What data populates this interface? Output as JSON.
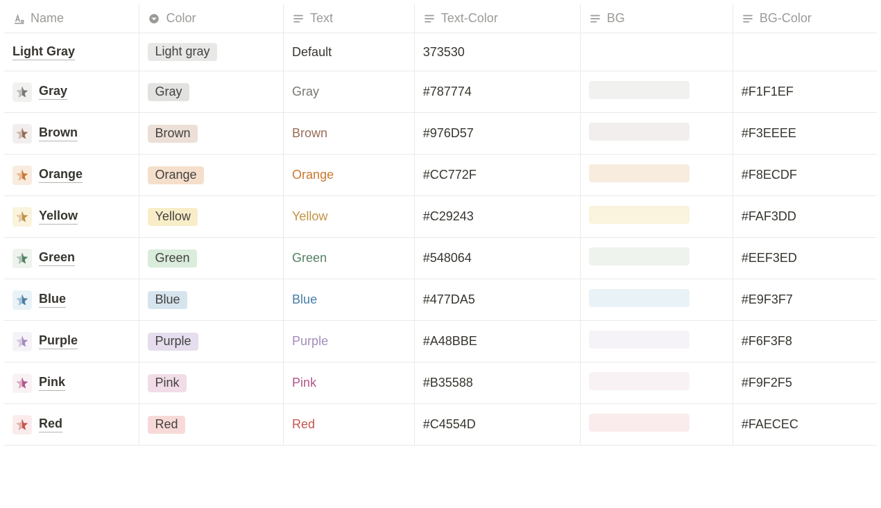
{
  "columns": {
    "name": "Name",
    "color": "Color",
    "text": "Text",
    "text_color": "Text-Color",
    "bg": "BG",
    "bg_color": "BG-Color"
  },
  "rows": [
    {
      "name": "Light Gray",
      "tag_label": "Light gray",
      "tag_bg": "#E8E8E6",
      "text": "Default",
      "text_hex": "373530",
      "text_css": "#373530",
      "bg_hex": "",
      "star_bg": "",
      "star_fill": ""
    },
    {
      "name": "Gray",
      "tag_label": "Gray",
      "tag_bg": "#E2E2E0",
      "text": "Gray",
      "text_hex": "#787774",
      "text_css": "#787774",
      "bg_hex": "#F1F1EF",
      "star_bg": "#F1F1EF",
      "star_fill": "#787774"
    },
    {
      "name": "Brown",
      "tag_label": "Brown",
      "tag_bg": "#ECDFD7",
      "text": "Brown",
      "text_hex": "#976D57",
      "text_css": "#976D57",
      "bg_hex": "#F3EEEE",
      "star_bg": "#F3EEEE",
      "star_fill": "#976D57"
    },
    {
      "name": "Orange",
      "tag_label": "Orange",
      "tag_bg": "#F5DFCC",
      "text": "Orange",
      "text_hex": "#CC772F",
      "text_css": "#CC772F",
      "bg_hex": "#F8ECDF",
      "star_bg": "#F8ECDF",
      "star_fill": "#CC772F"
    },
    {
      "name": "Yellow",
      "tag_label": "Yellow",
      "tag_bg": "#F9EDC8",
      "text": "Yellow",
      "text_hex": "#C29243",
      "text_css": "#C29243",
      "bg_hex": "#FAF3DD",
      "star_bg": "#FAF3DD",
      "star_fill": "#C29243"
    },
    {
      "name": "Green",
      "tag_label": "Green",
      "tag_bg": "#DAECDB",
      "text": "Green",
      "text_hex": "#548064",
      "text_css": "#548064",
      "bg_hex": "#EEF3ED",
      "star_bg": "#EEF3ED",
      "star_fill": "#548064"
    },
    {
      "name": "Blue",
      "tag_label": "Blue",
      "tag_bg": "#D6E4EE",
      "text": "Blue",
      "text_hex": "#477DA5",
      "text_css": "#477DA5",
      "bg_hex": "#E9F3F7",
      "star_bg": "#E9F3F7",
      "star_fill": "#477DA5"
    },
    {
      "name": "Purple",
      "tag_label": "Purple",
      "tag_bg": "#E6DDEE",
      "text": "Purple",
      "text_hex": "#A48BBE",
      "text_css": "#A48BBE",
      "bg_hex": "#F6F3F8",
      "star_bg": "#F6F3F8",
      "star_fill": "#A48BBE"
    },
    {
      "name": "Pink",
      "tag_label": "Pink",
      "tag_bg": "#F1DCE8",
      "text": "Pink",
      "text_hex": "#B35588",
      "text_css": "#B35588",
      "bg_hex": "#F9F2F5",
      "star_bg": "#F9F2F5",
      "star_fill": "#B35588"
    },
    {
      "name": "Red",
      "tag_label": "Red",
      "tag_bg": "#F7DAD7",
      "text": "Red",
      "text_hex": "#C4554D",
      "text_css": "#C4554D",
      "bg_hex": "#FAECEC",
      "star_bg": "#FAECEC",
      "star_fill": "#C4554D"
    }
  ]
}
